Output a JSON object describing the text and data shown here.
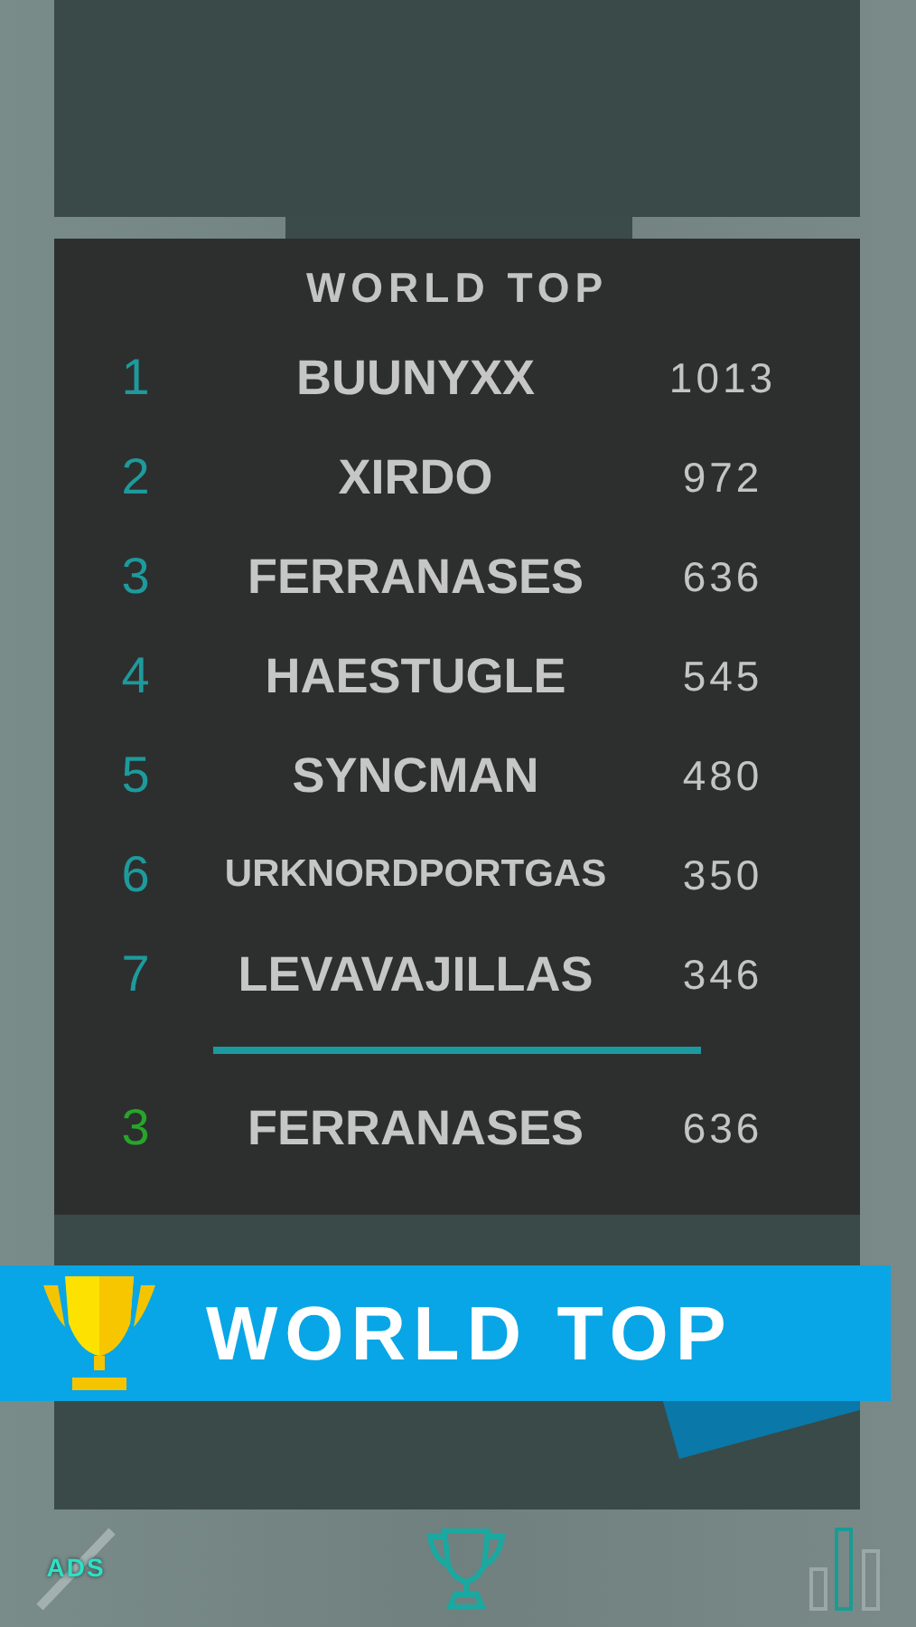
{
  "board": {
    "title": "WORLD TOP",
    "rows": [
      {
        "rank": "1",
        "name": "BUUNYXX",
        "score": "1013"
      },
      {
        "rank": "2",
        "name": "XIRDO",
        "score": "972"
      },
      {
        "rank": "3",
        "name": "FERRANASES",
        "score": "636"
      },
      {
        "rank": "4",
        "name": "HAESTUGLE",
        "score": "545"
      },
      {
        "rank": "5",
        "name": "SYNCMAN",
        "score": "480"
      },
      {
        "rank": "6",
        "name": "URKNORDPORTGAS",
        "score": "350"
      },
      {
        "rank": "7",
        "name": "LEVAVAJILLAS",
        "score": "346"
      }
    ],
    "player": {
      "rank": "3",
      "name": "FERRANASES",
      "score": "636"
    }
  },
  "banner": {
    "title": "WORLD TOP"
  },
  "nav": [
    {
      "kind": "ads",
      "label": "ADS",
      "selected": false
    },
    {
      "kind": "trophy",
      "selected": true
    },
    {
      "kind": "stats",
      "selected": false
    }
  ]
}
